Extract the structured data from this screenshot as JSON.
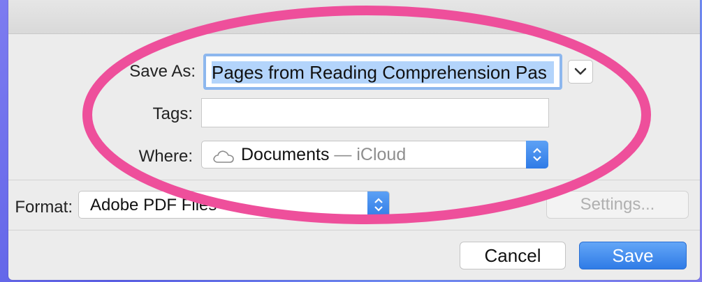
{
  "dialog": {
    "save_as_label": "Save As:",
    "save_as_value": "Pages from Reading Comprehension Pas",
    "tags_label": "Tags:",
    "tags_value": "",
    "where_label": "Where:",
    "where_folder": "Documents",
    "where_separator": "—",
    "where_location": "iCloud",
    "format_label": "Format:",
    "format_value": "Adobe PDF Files",
    "settings_label": "Settings...",
    "cancel_label": "Cancel",
    "save_label": "Save"
  },
  "icons": {
    "expand": "chevron-down-icon",
    "where": "cloud-icon",
    "stepper": "up-down-arrows-icon"
  },
  "colors": {
    "accent": "#2f7be6",
    "highlight_ring": "#ee4f9b",
    "selection": "#b3d4fb"
  }
}
